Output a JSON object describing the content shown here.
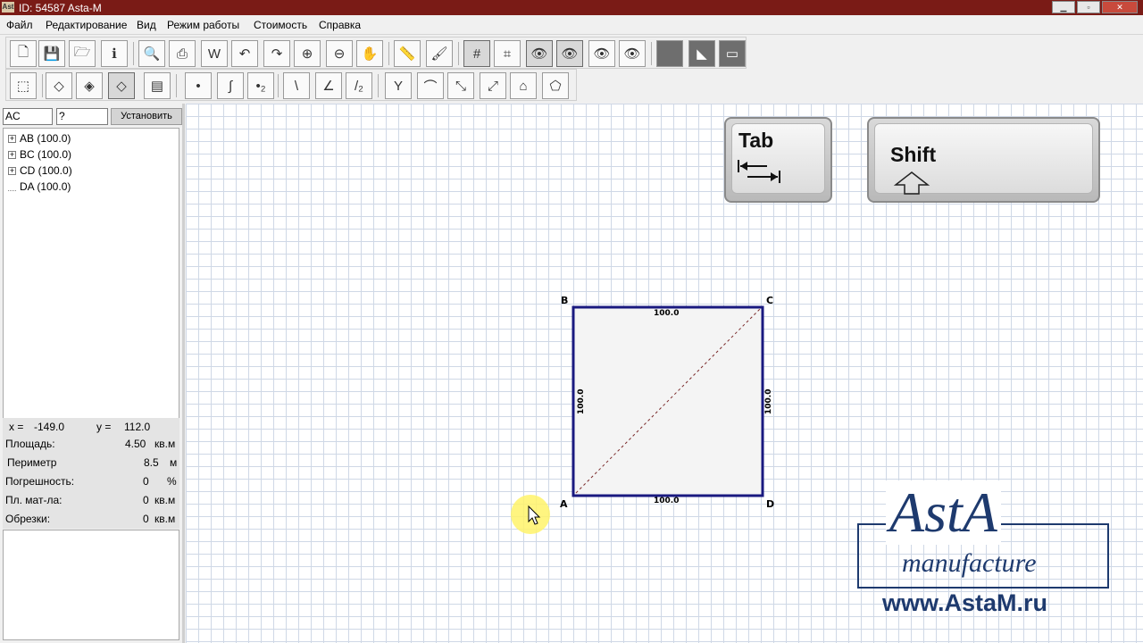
{
  "window": {
    "title": "ID: 54587 Asta-M",
    "app_icon_text": "Ast"
  },
  "menu": [
    "Файл",
    "Редактирование",
    "Вид",
    "Режим работы",
    "Стоимость",
    "Справка"
  ],
  "toolbar_icons_row1": [
    "new-doc-icon",
    "save-icon",
    "open-icon",
    "info-icon",
    "preview-icon",
    "print-icon",
    "export-word-icon",
    "undo-icon",
    "redo-icon",
    "zoom-in-icon",
    "zoom-out-icon",
    "pan-hand-icon",
    "ruler-icon",
    "brush-icon",
    "grid-icon",
    "snap-grid-icon",
    "view-eye-icon",
    "view-eye-2-icon",
    "view-eye-3-icon",
    "view-eye-4-icon",
    "fill-dark-icon",
    "corner-icon",
    "panel-icon"
  ],
  "toolbar_icons_row2": [
    "3d-view-icon",
    "shape-1-icon",
    "shape-2-icon",
    "shape-3-icon",
    "layers-icon",
    "point-icon",
    "curve-icon",
    "point-2-icon",
    "vertex-icon",
    "angle-icon",
    "angle-2-icon",
    "tool-a-icon",
    "tool-b-icon",
    "tool-c-icon",
    "tool-d-icon",
    "tool-e-icon",
    "tool-f-icon"
  ],
  "panel": {
    "field1": "AC",
    "field2": "?",
    "set_button": "Установить",
    "tree": [
      {
        "label": "AB (100.0)",
        "expandable": true
      },
      {
        "label": "BC (100.0)",
        "expandable": true
      },
      {
        "label": "CD (100.0)",
        "expandable": true
      },
      {
        "label": "DA (100.0)",
        "expandable": false
      }
    ],
    "coords": {
      "x_label": "x =",
      "x_value": "-149.0",
      "y_label": "y =",
      "y_value": "112.0"
    },
    "stats": [
      {
        "label": "Площадь:",
        "value": "4.50",
        "unit": "кв.м"
      },
      {
        "label": "Периметр",
        "value": "8.5",
        "unit": "м"
      },
      {
        "label": "Погрешность:",
        "value": "0",
        "unit": "%"
      },
      {
        "label": "Пл. мат-ла:",
        "value": "0",
        "unit": "кв.м"
      },
      {
        "label": "Обрезки:",
        "value": "0",
        "unit": "кв.м"
      }
    ]
  },
  "drawing": {
    "vertices": {
      "A": "A",
      "B": "B",
      "C": "C",
      "D": "D"
    },
    "edge_labels": {
      "top": "100.0",
      "bottom": "100.0",
      "left": "100.0",
      "right": "100.0"
    }
  },
  "keys": {
    "tab": "Tab",
    "shift": "Shift"
  },
  "logo": {
    "brand": "AstA",
    "sub": "manufacture",
    "url": "www.AstaM.ru"
  },
  "colors": {
    "titlebar": "#7a1b16",
    "shape_edge": "#1a1a80",
    "logo": "#1e3a6e",
    "cursor_highlight": "#fff36a"
  }
}
